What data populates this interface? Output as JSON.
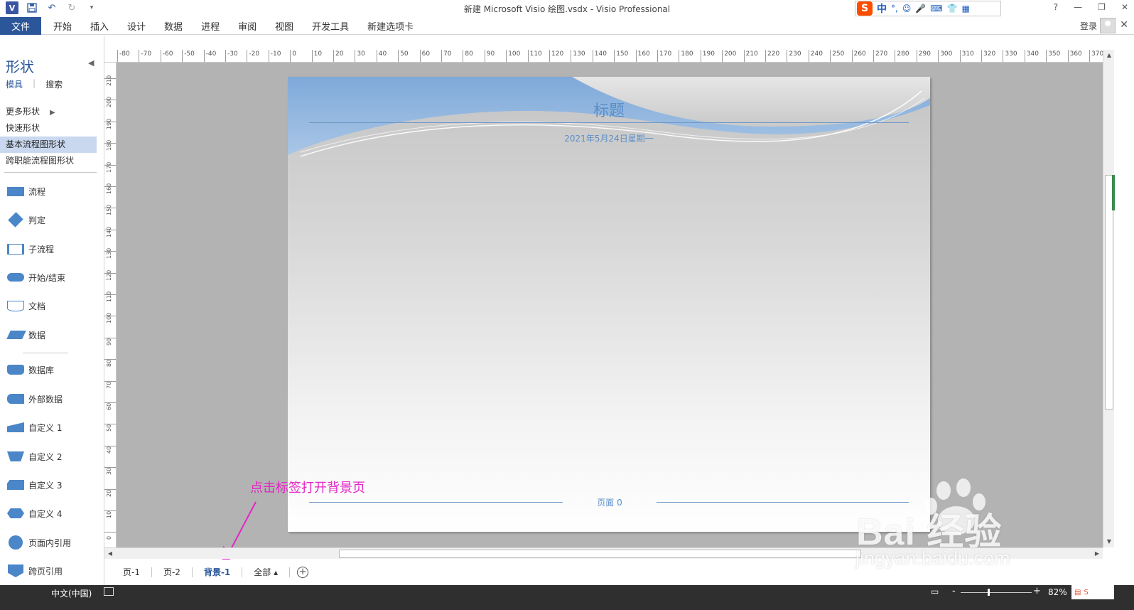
{
  "window": {
    "title": "新建 Microsoft Visio 绘图.vsdx - Visio Professional",
    "app_badge": "V",
    "controls": {
      "help": "?",
      "minimize": "—",
      "restore": "❐",
      "close": "✕"
    }
  },
  "ime": {
    "logo": "S",
    "mode": "中",
    "punct": "°,",
    "icons": [
      "☺",
      "🎤",
      "⌨",
      "👕",
      "▦"
    ]
  },
  "ribbon": {
    "file_label": "文件",
    "tabs": [
      "开始",
      "插入",
      "设计",
      "数据",
      "进程",
      "审阅",
      "视图",
      "开发工具",
      "新建选项卡"
    ],
    "login_label": "登录"
  },
  "shapes_pane": {
    "title": "形状",
    "tab_stencils": "模具",
    "tab_search": "搜索",
    "stencils": [
      "更多形状",
      "快速形状",
      "基本流程图形状",
      "跨职能流程图形状"
    ],
    "masters": [
      "流程",
      "判定",
      "子流程",
      "开始/结束",
      "文档",
      "数据",
      "数据库",
      "外部数据",
      "自定义 1",
      "自定义 2",
      "自定义 3",
      "自定义 4",
      "页面内引用",
      "跨页引用"
    ]
  },
  "rulers": {
    "horizontal": [
      "-80",
      "-70",
      "-60",
      "-50",
      "-40",
      "-30",
      "-20",
      "-10",
      "0",
      "10",
      "20",
      "30",
      "40",
      "50",
      "60",
      "70",
      "80",
      "90",
      "100",
      "110",
      "120",
      "130",
      "140",
      "150",
      "160",
      "170",
      "180",
      "190",
      "200",
      "210",
      "220",
      "230",
      "240",
      "250",
      "260",
      "270",
      "280",
      "290",
      "300",
      "310",
      "320",
      "330",
      "340",
      "350",
      "360",
      "370"
    ],
    "vertical": [
      "210",
      "200",
      "190",
      "180",
      "170",
      "160",
      "150",
      "140",
      "130",
      "120",
      "110",
      "100",
      "90",
      "80",
      "70",
      "60",
      "50",
      "40",
      "30",
      "20",
      "10",
      "0"
    ]
  },
  "page": {
    "title": "标题",
    "date": "2021年5月24日星期一",
    "footer": "页面 0"
  },
  "annotation": {
    "text": "点击标签打开背景页",
    "color": "#e325c6"
  },
  "page_tabs": [
    "页-1",
    "页-2",
    "背景-1",
    "全部 ▴"
  ],
  "active_page_tab": "背景-1",
  "statusbar": {
    "language": "中文(中国)",
    "zoom_minus": "-",
    "zoom_plus": "+",
    "zoom_level": "82%"
  },
  "watermark": {
    "brand": "Bai 经验",
    "url": "jingyan.baidu.com"
  },
  "colors": {
    "accent": "#2b579a",
    "canvas_bg": "#b3b3b3",
    "theme_blue": "#5b8fc9",
    "annotation": "#e325c6"
  }
}
